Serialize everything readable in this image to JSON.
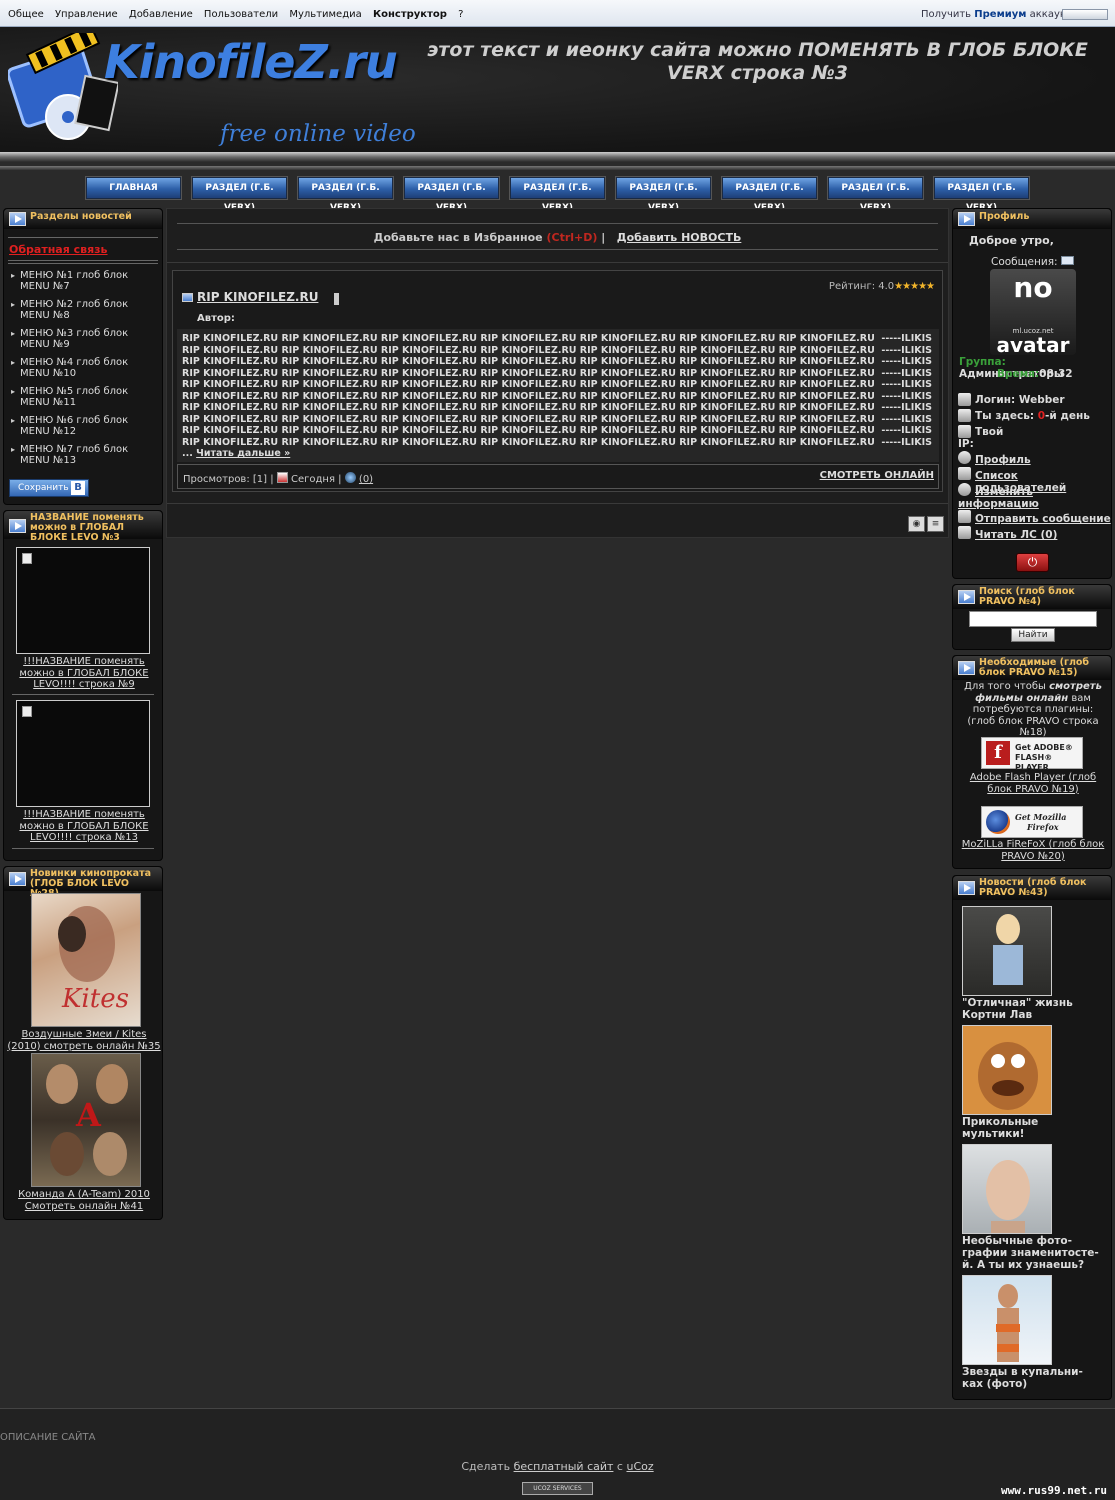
{
  "adminbar": {
    "menu": [
      "Общее",
      "Управление",
      "Добавление",
      "Пользователи",
      "Мультимедиа",
      "Конструктор",
      "?"
    ],
    "premium_pre": "Получить",
    "premium_bold": "Премиум",
    "premium_post": "аккаунт"
  },
  "header": {
    "logo_title": "KinofileZ.ru",
    "logo_subtitle": "free online video",
    "text": "этот текст и иеонку сайта можно ПОМЕНЯТЬ В ГЛОБ БЛОКЕ VERX строка №3"
  },
  "nav": {
    "items": [
      "ГЛАВНАЯ",
      "РАЗДЕЛ (Г.Б. VERX)",
      "РАЗДЕЛ (Г.Б. VERX)",
      "РАЗДЕЛ (Г.Б. VERX)",
      "РАЗДЕЛ (Г.Б. VERX)",
      "РАЗДЕЛ (Г.Б. VERX)",
      "РАЗДЕЛ (Г.Б. VERX)",
      "РАЗДЕЛ (Г.Б. VERX)",
      "РАЗДЕЛ (Г.Б. VERX)"
    ]
  },
  "left": {
    "news_sections": {
      "title": "Разделы новостей",
      "feedback_link": "Обратная связь",
      "items": [
        "МЕНЮ №1 глоб блок MENU №7",
        "МЕНЮ №2 глоб блок MENU №8",
        "МЕНЮ №3 глоб блок MENU №9",
        "МЕНЮ №4 глоб блок MENU №10",
        "МЕНЮ №5 глоб блок MENU №11",
        "МЕНЮ №6 глоб блок MENU №12",
        "МЕНЮ №7 глоб блок MENU №13"
      ],
      "save_label": "Сохранить",
      "save_badge": "В"
    },
    "block2": {
      "title": "НАЗВАНИЕ поменять можно в ГЛОБАЛ БЛОКЕ LEVO №3",
      "caption1": "!!!НАЗВАНИЕ поменять можно в ГЛОБАЛ БЛОКЕ LEVO!!!! строка №9",
      "caption2": "!!!НАЗВАНИЕ поменять можно в ГЛОБАЛ БЛОКЕ LEVO!!!! строка №13"
    },
    "new_movies": {
      "title": "Новинки кинопроката (ГЛОБ БЛОК LEVO №28)",
      "movie1": "Воздушные Змеи / Kites (2010) смотреть онлайн №35",
      "movie1_poster_text": "Kites",
      "movie2": "Команда А (A-Team) 2010 Смотреть онлайн №41",
      "movie2_poster_text": "A"
    }
  },
  "main": {
    "bookmark_text": "Добавьте нас в Избранное",
    "bookmark_keys": "(Ctrl+D)",
    "bookmark_sep": "|",
    "add_news": "Добавить НОВОСТЬ",
    "entry": {
      "rating_label": "Рейтинг: 4.0",
      "rating_stars": "★★★★★",
      "title": "RIP KINOFILEZ.RU",
      "author_label": "Автор:",
      "body": "RIP KINOFILEZ.RU RIP KINOFILEZ.RU RIP KINOFILEZ.RU RIP KINOFILEZ.RU RIP KINOFILEZ.RU RIP KINOFILEZ.RU RIP KINOFILEZ.RU  -----ILIKIS\nRIP KINOFILEZ.RU RIP KINOFILEZ.RU RIP KINOFILEZ.RU RIP KINOFILEZ.RU RIP KINOFILEZ.RU RIP KINOFILEZ.RU RIP KINOFILEZ.RU  -----ILIKIS\nRIP KINOFILEZ.RU RIP KINOFILEZ.RU RIP KINOFILEZ.RU RIP KINOFILEZ.RU RIP KINOFILEZ.RU RIP KINOFILEZ.RU RIP KINOFILEZ.RU  -----ILIKIS\nRIP KINOFILEZ.RU RIP KINOFILEZ.RU RIP KINOFILEZ.RU RIP KINOFILEZ.RU RIP KINOFILEZ.RU RIP KINOFILEZ.RU RIP KINOFILEZ.RU  -----ILIKIS\nRIP KINOFILEZ.RU RIP KINOFILEZ.RU RIP KINOFILEZ.RU RIP KINOFILEZ.RU RIP KINOFILEZ.RU RIP KINOFILEZ.RU RIP KINOFILEZ.RU  -----ILIKIS\nRIP KINOFILEZ.RU RIP KINOFILEZ.RU RIP KINOFILEZ.RU RIP KINOFILEZ.RU RIP KINOFILEZ.RU RIP KINOFILEZ.RU RIP KINOFILEZ.RU  -----ILIKIS\nRIP KINOFILEZ.RU RIP KINOFILEZ.RU RIP KINOFILEZ.RU RIP KINOFILEZ.RU RIP KINOFILEZ.RU RIP KINOFILEZ.RU RIP KINOFILEZ.RU  -----ILIKIS\nRIP KINOFILEZ.RU RIP KINOFILEZ.RU RIP KINOFILEZ.RU RIP KINOFILEZ.RU RIP KINOFILEZ.RU RIP KINOFILEZ.RU RIP KINOFILEZ.RU  -----ILIKIS\nRIP KINOFILEZ.RU RIP KINOFILEZ.RU RIP KINOFILEZ.RU RIP KINOFILEZ.RU RIP KINOFILEZ.RU RIP KINOFILEZ.RU RIP KINOFILEZ.RU  -----ILIKIS\nRIP KINOFILEZ.RU RIP KINOFILEZ.RU RIP KINOFILEZ.RU RIP KINOFILEZ.RU RIP KINOFILEZ.RU RIP KINOFILEZ.RU RIP KINOFILEZ.RU  -----ILIKIS",
      "more_prefix": "...",
      "more_link": "Читать дальше »",
      "views_label": "Просмотров:",
      "views_value": "[1]",
      "sep": "|",
      "date": "Сегодня",
      "comments": "(0)",
      "watch_link": "СМОТРЕТЬ ОНЛАЙН"
    }
  },
  "right": {
    "profile": {
      "title": "Профиль",
      "greeting": "Доброе утро,",
      "messages_label": "Сообщения:",
      "avatar_top": "no",
      "avatar_domain": "ml.ucoz.net",
      "avatar_text": "avatar",
      "group_label": "Группа:",
      "group_value": "Администраторы",
      "time_label": "Время:",
      "time_value": "08:32",
      "login_label": "Логин:",
      "login_value": "Webber",
      "here_label": "Ты здесь:",
      "here_value": "0",
      "here_suffix": "-й день",
      "ip_label": "Твой IP:",
      "links": [
        "Профиль",
        "Список пользователей",
        "Изменить информацию",
        "Отправить сообщение",
        "Читать ЛС (0)"
      ]
    },
    "search": {
      "title": "Поиск (глоб блок PRAVO №4)",
      "button": "Найти"
    },
    "required": {
      "title": "Необходимые (глоб блок PRAVO №15)",
      "text_pre": "Для того чтобы ",
      "text_em": "смотреть фильмы онлайн",
      "text_post": " вам потребуются плагины: (глоб блок PRAVO строка №18)",
      "flash_btn_line1": "Get ADOBE®",
      "flash_btn_line2": "FLASH® PLAYER",
      "flash_btn_logo": "f",
      "flash_caption": "Adobe Flash Player (глоб блок PRAVO №19)",
      "ff_btn_line1": "Get Mozilla",
      "ff_btn_line2": "Firefox",
      "ff_caption": "MoZiLLa FiReFoX (глоб блок PRAVO №20)"
    },
    "news": {
      "title": "Новости (глоб блок PRAVO №43)",
      "items": [
        "\"Отличная\" жизнь Кортни Лав",
        "Прикольные мультики!",
        "Необычные фото-графии знаменитосте-й. А ты их узнаешь?",
        "Звезды в купальни-ках (фото)"
      ]
    }
  },
  "footer": {
    "description": "ОПИСАНИЕ САЙТА",
    "make_pre": "Сделать",
    "make_link": "бесплатный сайт",
    "make_mid": "с",
    "make_ucoz": "uCoz",
    "badge": "UCOZ SERVICES",
    "watermark": "www.rus99.net.ru"
  },
  "colors": {
    "accent_blue": "#3d7fe0",
    "panel_title": "#f0c060",
    "feedback_red": "#e02020",
    "background": "#2a2a2a"
  }
}
